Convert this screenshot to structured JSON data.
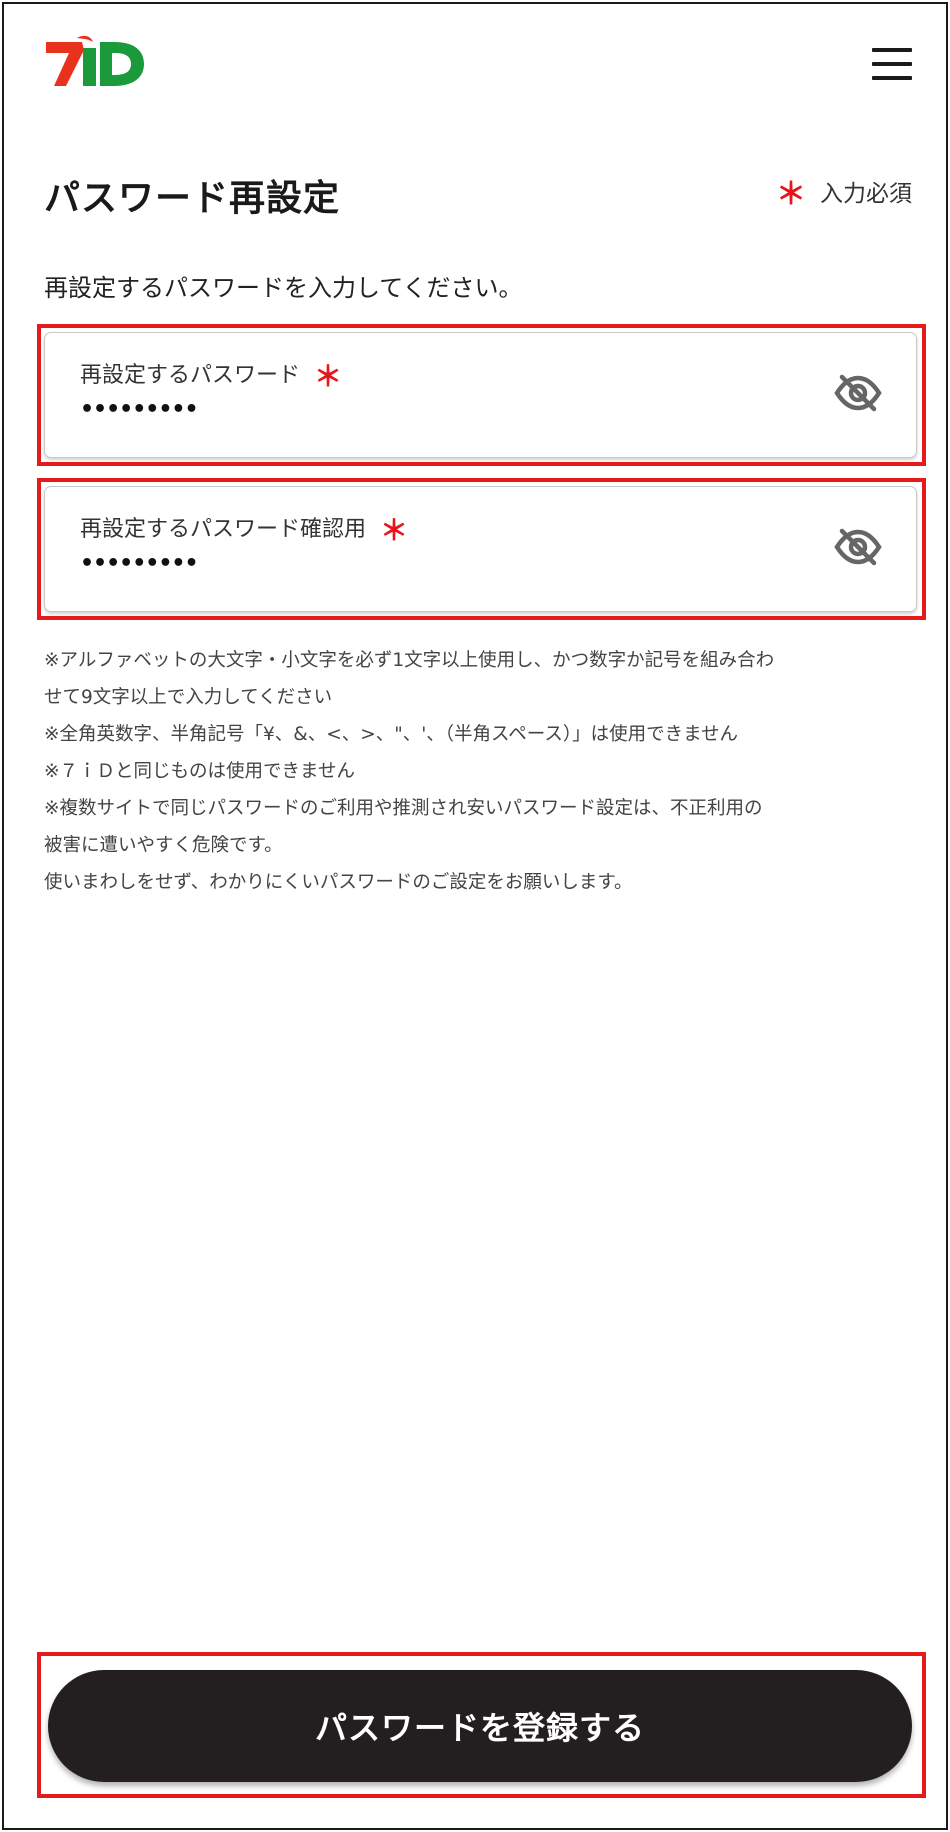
{
  "header": {
    "logo_text": "7iD",
    "menu_icon": "hamburger-menu-icon"
  },
  "page": {
    "title": "パスワード再設定",
    "required_mark": "＊",
    "required_label": "入力必須",
    "instruction": "再設定するパスワードを入力してください。"
  },
  "fields": [
    {
      "label": "再設定するパスワード",
      "required_mark": "＊",
      "value": "•••••••••",
      "toggle_icon": "eye-slash-icon"
    },
    {
      "label": "再設定するパスワード確認用",
      "required_mark": "＊",
      "value": "•••••••••",
      "toggle_icon": "eye-slash-icon"
    }
  ],
  "notes": [
    "※アルファベットの大文字・小文字を必ず1文字以上使用し、かつ数字か記号を組み合わ",
    "せて9文字以上で入力してください",
    "※全角英数字、半角記号「¥、&、<、>、\"、'、（半角スペース）」は使用できません",
    "※７ｉＤと同じものは使用できません",
    "※複数サイトで同じパスワードのご利用や推測され安いパスワード設定は、不正利用の",
    "被害に遭いやすく危険です。",
    "使いまわしをせず、わかりにくいパスワードのご設定をお願いします。"
  ],
  "submit_button": {
    "label": "パスワードを登録する"
  },
  "colors": {
    "logo_red": "#e8321e",
    "logo_green": "#1a9a3a",
    "required_red": "#e8141b",
    "highlight_red": "#e31b1b",
    "button_bg": "#231f20"
  }
}
